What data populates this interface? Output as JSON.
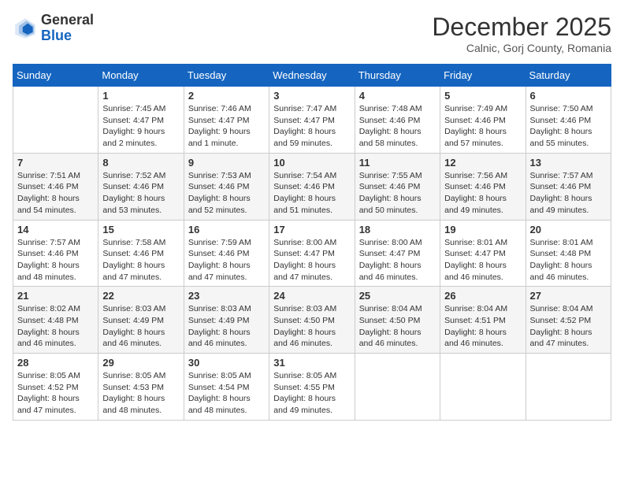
{
  "logo": {
    "general": "General",
    "blue": "Blue"
  },
  "title": "December 2025",
  "subtitle": "Calnic, Gorj County, Romania",
  "days_of_week": [
    "Sunday",
    "Monday",
    "Tuesday",
    "Wednesday",
    "Thursday",
    "Friday",
    "Saturday"
  ],
  "weeks": [
    [
      {
        "day": "",
        "info": ""
      },
      {
        "day": "1",
        "info": "Sunrise: 7:45 AM\nSunset: 4:47 PM\nDaylight: 9 hours\nand 2 minutes."
      },
      {
        "day": "2",
        "info": "Sunrise: 7:46 AM\nSunset: 4:47 PM\nDaylight: 9 hours\nand 1 minute."
      },
      {
        "day": "3",
        "info": "Sunrise: 7:47 AM\nSunset: 4:47 PM\nDaylight: 8 hours\nand 59 minutes."
      },
      {
        "day": "4",
        "info": "Sunrise: 7:48 AM\nSunset: 4:46 PM\nDaylight: 8 hours\nand 58 minutes."
      },
      {
        "day": "5",
        "info": "Sunrise: 7:49 AM\nSunset: 4:46 PM\nDaylight: 8 hours\nand 57 minutes."
      },
      {
        "day": "6",
        "info": "Sunrise: 7:50 AM\nSunset: 4:46 PM\nDaylight: 8 hours\nand 55 minutes."
      }
    ],
    [
      {
        "day": "7",
        "info": "Sunrise: 7:51 AM\nSunset: 4:46 PM\nDaylight: 8 hours\nand 54 minutes."
      },
      {
        "day": "8",
        "info": "Sunrise: 7:52 AM\nSunset: 4:46 PM\nDaylight: 8 hours\nand 53 minutes."
      },
      {
        "day": "9",
        "info": "Sunrise: 7:53 AM\nSunset: 4:46 PM\nDaylight: 8 hours\nand 52 minutes."
      },
      {
        "day": "10",
        "info": "Sunrise: 7:54 AM\nSunset: 4:46 PM\nDaylight: 8 hours\nand 51 minutes."
      },
      {
        "day": "11",
        "info": "Sunrise: 7:55 AM\nSunset: 4:46 PM\nDaylight: 8 hours\nand 50 minutes."
      },
      {
        "day": "12",
        "info": "Sunrise: 7:56 AM\nSunset: 4:46 PM\nDaylight: 8 hours\nand 49 minutes."
      },
      {
        "day": "13",
        "info": "Sunrise: 7:57 AM\nSunset: 4:46 PM\nDaylight: 8 hours\nand 49 minutes."
      }
    ],
    [
      {
        "day": "14",
        "info": "Sunrise: 7:57 AM\nSunset: 4:46 PM\nDaylight: 8 hours\nand 48 minutes."
      },
      {
        "day": "15",
        "info": "Sunrise: 7:58 AM\nSunset: 4:46 PM\nDaylight: 8 hours\nand 47 minutes."
      },
      {
        "day": "16",
        "info": "Sunrise: 7:59 AM\nSunset: 4:46 PM\nDaylight: 8 hours\nand 47 minutes."
      },
      {
        "day": "17",
        "info": "Sunrise: 8:00 AM\nSunset: 4:47 PM\nDaylight: 8 hours\nand 47 minutes."
      },
      {
        "day": "18",
        "info": "Sunrise: 8:00 AM\nSunset: 4:47 PM\nDaylight: 8 hours\nand 46 minutes."
      },
      {
        "day": "19",
        "info": "Sunrise: 8:01 AM\nSunset: 4:47 PM\nDaylight: 8 hours\nand 46 minutes."
      },
      {
        "day": "20",
        "info": "Sunrise: 8:01 AM\nSunset: 4:48 PM\nDaylight: 8 hours\nand 46 minutes."
      }
    ],
    [
      {
        "day": "21",
        "info": "Sunrise: 8:02 AM\nSunset: 4:48 PM\nDaylight: 8 hours\nand 46 minutes."
      },
      {
        "day": "22",
        "info": "Sunrise: 8:03 AM\nSunset: 4:49 PM\nDaylight: 8 hours\nand 46 minutes."
      },
      {
        "day": "23",
        "info": "Sunrise: 8:03 AM\nSunset: 4:49 PM\nDaylight: 8 hours\nand 46 minutes."
      },
      {
        "day": "24",
        "info": "Sunrise: 8:03 AM\nSunset: 4:50 PM\nDaylight: 8 hours\nand 46 minutes."
      },
      {
        "day": "25",
        "info": "Sunrise: 8:04 AM\nSunset: 4:50 PM\nDaylight: 8 hours\nand 46 minutes."
      },
      {
        "day": "26",
        "info": "Sunrise: 8:04 AM\nSunset: 4:51 PM\nDaylight: 8 hours\nand 46 minutes."
      },
      {
        "day": "27",
        "info": "Sunrise: 8:04 AM\nSunset: 4:52 PM\nDaylight: 8 hours\nand 47 minutes."
      }
    ],
    [
      {
        "day": "28",
        "info": "Sunrise: 8:05 AM\nSunset: 4:52 PM\nDaylight: 8 hours\nand 47 minutes."
      },
      {
        "day": "29",
        "info": "Sunrise: 8:05 AM\nSunset: 4:53 PM\nDaylight: 8 hours\nand 48 minutes."
      },
      {
        "day": "30",
        "info": "Sunrise: 8:05 AM\nSunset: 4:54 PM\nDaylight: 8 hours\nand 48 minutes."
      },
      {
        "day": "31",
        "info": "Sunrise: 8:05 AM\nSunset: 4:55 PM\nDaylight: 8 hours\nand 49 minutes."
      },
      {
        "day": "",
        "info": ""
      },
      {
        "day": "",
        "info": ""
      },
      {
        "day": "",
        "info": ""
      }
    ]
  ]
}
